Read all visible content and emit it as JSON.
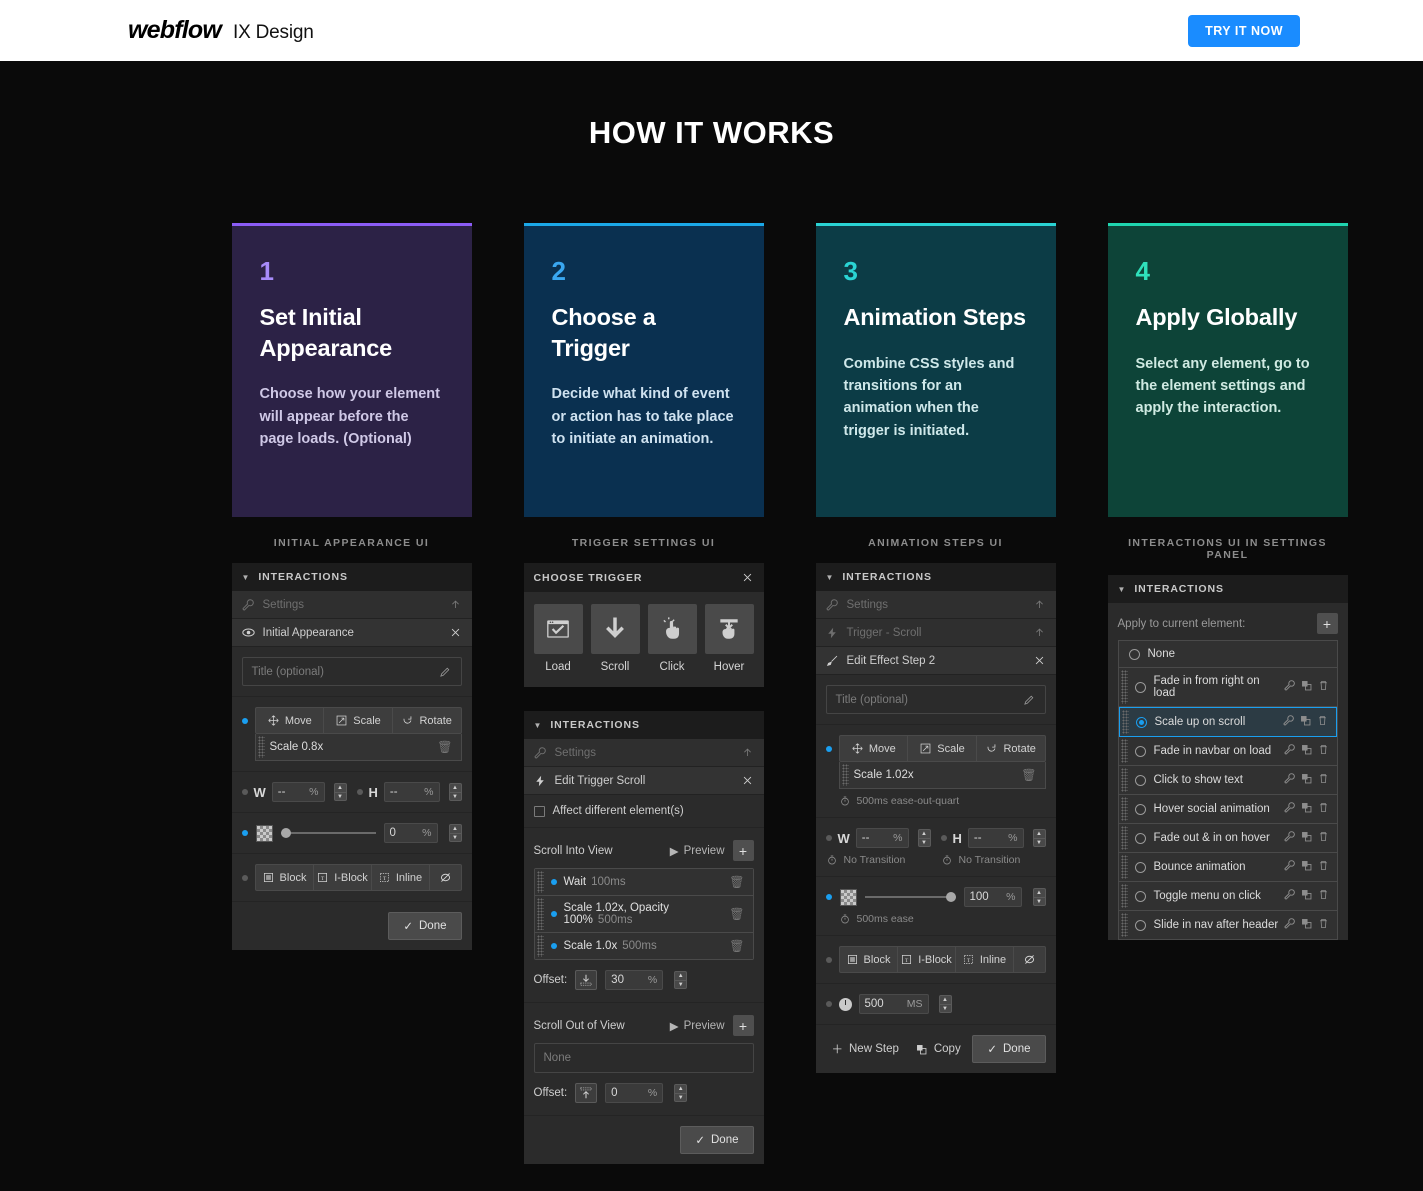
{
  "topbar": {
    "logo": "webflow",
    "product": "IX Design",
    "cta": "TRY IT NOW",
    "cta_color": "#1a8cff"
  },
  "page": {
    "title": "HOW IT WORKS"
  },
  "cards": [
    {
      "num": "1",
      "title": "Set Initial Appearance",
      "desc": "Choose how your element will appear before the page loads. (Optional)",
      "ui_label": "INITIAL APPEARANCE UI",
      "bg": "#2c2246",
      "accent": "#8b5cf6",
      "num_color": "#a78bfa",
      "desc_color": "#cfc8e6"
    },
    {
      "num": "2",
      "title": "Choose a Trigger",
      "desc": "Decide what kind of event or action has to take place to initiate an animation.",
      "ui_label": "TRIGGER SETTINGS UI",
      "bg": "#0a3050",
      "accent": "#1ba8e8",
      "num_color": "#3aa7f0",
      "desc_color": "#cfe2f0"
    },
    {
      "num": "3",
      "title": "Animation Steps",
      "desc": "Combine CSS styles and transitions for an animation when the trigger is initiated.",
      "ui_label": "ANIMATION STEPS UI",
      "bg": "#0c3c46",
      "accent": "#2ad4d4",
      "num_color": "#2ad4d4",
      "desc_color": "#cfe8ea"
    },
    {
      "num": "4",
      "title": "Apply Globally",
      "desc": "Select any element, go to the element settings and apply the interaction.",
      "ui_label": "INTERACTIONS UI IN SETTINGS PANEL",
      "bg": "#0d4438",
      "accent": "#1fd6b0",
      "num_color": "#2fe0bb",
      "desc_color": "#cfeae2"
    }
  ],
  "panel1": {
    "header": "INTERACTIONS",
    "settings_row": "Settings",
    "effect_row": "Initial Appearance",
    "title_placeholder": "Title (optional)",
    "transform_tabs": [
      "Move",
      "Scale",
      "Rotate"
    ],
    "transform_chip": "Scale 0.8x",
    "width_label": "W",
    "width_value": "--",
    "height_label": "H",
    "height_value": "--",
    "unit": "%",
    "opacity_value": "0",
    "display_tabs": [
      "Block",
      "I-Block",
      "Inline"
    ],
    "done_label": "Done"
  },
  "panel2": {
    "chooser_title": "CHOOSE TRIGGER",
    "triggers": [
      {
        "label": "Load",
        "icon": "window-check-icon"
      },
      {
        "label": "Scroll",
        "icon": "arrow-down-icon"
      },
      {
        "label": "Click",
        "icon": "hand-click-icon"
      },
      {
        "label": "Hover",
        "icon": "hand-hover-icon"
      }
    ],
    "header": "INTERACTIONS",
    "settings_row": "Settings",
    "trigger_row": "Edit Trigger Scroll",
    "affect_label": "Affect different element(s)",
    "into_view_label": "Scroll Into View",
    "preview_label": "Preview",
    "into_steps": [
      {
        "name": "Wait",
        "time": "100ms"
      },
      {
        "name": "Scale 1.02x, Opacity 100%",
        "time": "500ms"
      },
      {
        "name": "Scale 1.0x",
        "time": "500ms"
      }
    ],
    "offset_label": "Offset:",
    "offset_into": "30",
    "out_view_label": "Scroll Out of View",
    "out_steps_none": "None",
    "offset_out": "0",
    "unit": "%",
    "done_label": "Done"
  },
  "panel3": {
    "header": "INTERACTIONS",
    "settings_row": "Settings",
    "trigger_row": "Trigger - Scroll",
    "effect_row": "Edit Effect Step 2",
    "title_placeholder": "Title (optional)",
    "transform_tabs": [
      "Move",
      "Scale",
      "Rotate"
    ],
    "transform_chip": "Scale 1.02x",
    "transform_note": "500ms ease-out-quart",
    "width_label": "W",
    "width_value": "--",
    "width_note": "No Transition",
    "height_label": "H",
    "height_value": "--",
    "height_note": "No Transition",
    "unit": "%",
    "opacity_value": "100",
    "opacity_note": "500ms ease",
    "display_tabs": [
      "Block",
      "I-Block",
      "Inline"
    ],
    "duration_value": "500",
    "duration_unit": "MS",
    "new_step_label": "New Step",
    "copy_label": "Copy",
    "done_label": "Done"
  },
  "panel4": {
    "header": "INTERACTIONS",
    "apply_label": "Apply to current element:",
    "interactions": [
      {
        "label": "None",
        "selected": false,
        "none": true
      },
      {
        "label": "Fade in from right on load",
        "selected": false
      },
      {
        "label": "Scale up on scroll",
        "selected": true
      },
      {
        "label": "Fade in navbar on load",
        "selected": false
      },
      {
        "label": "Click to show text",
        "selected": false
      },
      {
        "label": "Hover social animation",
        "selected": false
      },
      {
        "label": "Fade out & in on hover",
        "selected": false
      },
      {
        "label": "Bounce animation",
        "selected": false
      },
      {
        "label": "Toggle menu on click",
        "selected": false
      },
      {
        "label": "Slide in nav after header",
        "selected": false
      }
    ],
    "accent": "#1a9ff0"
  }
}
